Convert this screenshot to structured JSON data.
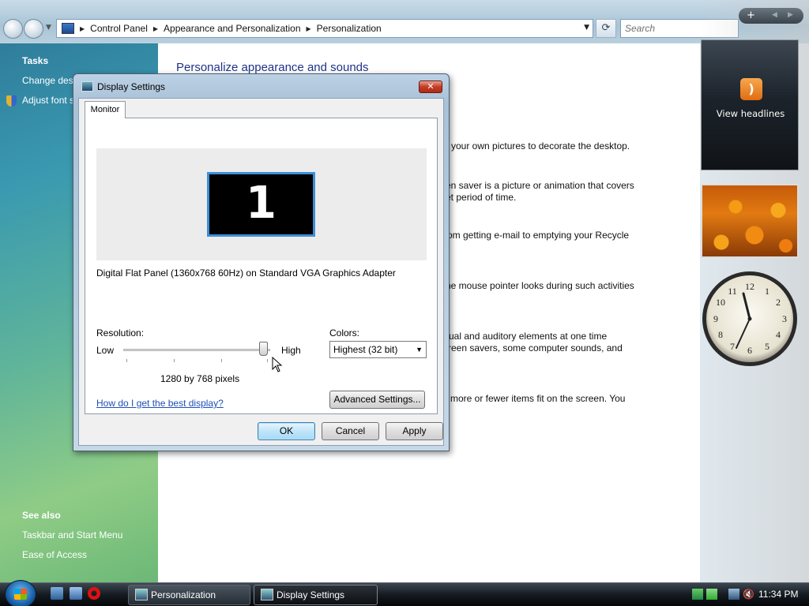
{
  "explorer": {
    "breadcrumb": [
      "Control Panel",
      "Appearance and Personalization",
      "Personalization"
    ],
    "search_placeholder": "Search"
  },
  "left_pane": {
    "tasks_heading": "Tasks",
    "tasks": [
      "Change desktop icons",
      "Adjust font size (DPI)"
    ],
    "see_also_heading": "See also",
    "see_also": [
      "Taskbar and Start Menu",
      "Ease of Access"
    ]
  },
  "main": {
    "title": "Personalize appearance and sounds",
    "descriptions": [
      "your own pictures to decorate the desktop.",
      "en saver is a picture or animation that covers",
      "et period of time.",
      "om getting e-mail to emptying your Recycle",
      "he mouse pointer looks during such activities",
      "ual and auditory elements at one time",
      "reen savers, some computer sounds, and",
      "more or fewer items fit on the screen. You"
    ]
  },
  "dialog": {
    "title": "Display Settings",
    "close_label": "✕",
    "tab": "Monitor",
    "monitor_number": "1",
    "monitor_name": "Digital Flat Panel (1360x768 60Hz) on Standard VGA Graphics Adapter",
    "resolution_label": "Resolution:",
    "low_label": "Low",
    "high_label": "High",
    "resolution_value": "1280 by 768 pixels",
    "resolution_slider_position": 0.98,
    "colors_label": "Colors:",
    "colors_selected": "Highest (32 bit)",
    "help_link": "How do I get the best display?",
    "advanced_button": "Advanced Settings...",
    "ok_button": "OK",
    "cancel_button": "Cancel",
    "apply_button": "Apply"
  },
  "sidebar": {
    "controls": {
      "add": "+",
      "prev": "◀",
      "next": "▶"
    },
    "feed_label": "View headlines",
    "clock_time": "11:34"
  },
  "taskbar": {
    "buttons": [
      "Personalization",
      "Display Settings"
    ],
    "time": "11:34 PM"
  },
  "colors": {
    "accent": "#3c8fd8",
    "link": "#1f4fb5",
    "title_blue": "#1e3287"
  }
}
